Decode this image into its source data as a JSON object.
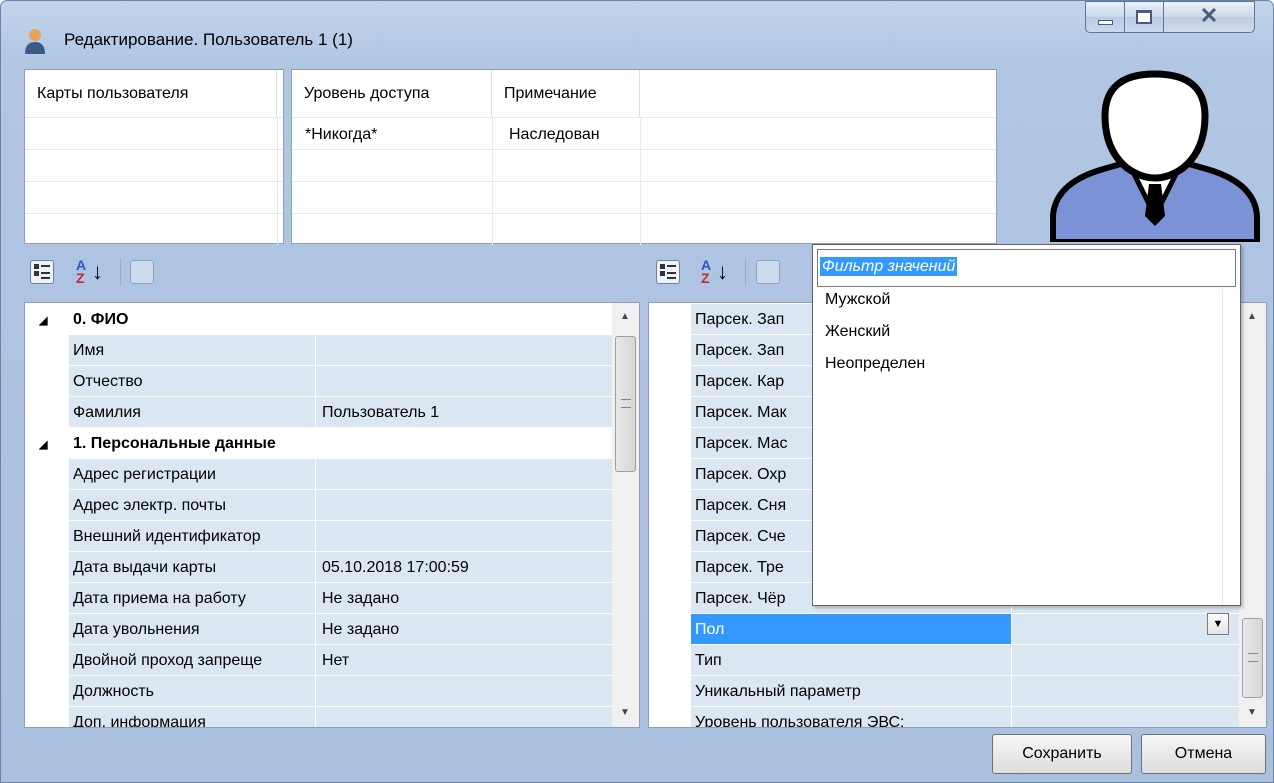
{
  "window": {
    "title": "Редактирование. Пользователь 1 (1)",
    "icons": {
      "app": "user-icon",
      "minimize": "minimize-icon",
      "maximize": "maximize-icon",
      "close": "close-icon"
    }
  },
  "cards_panel": {
    "header": "Карты пользователя"
  },
  "access_panel": {
    "headers": [
      "Уровень доступа",
      "Примечание"
    ],
    "rows": [
      {
        "level": "*Никогда*",
        "note": "Наследован"
      }
    ]
  },
  "avatar": {
    "icon": "person-avatar-icon"
  },
  "left_toolbar": {
    "icons": [
      "categorized-icon",
      "sort-az-icon",
      "property-pages-icon"
    ]
  },
  "right_toolbar": {
    "icons": [
      "categorized-icon",
      "sort-az-icon",
      "property-pages-icon"
    ]
  },
  "left_grid": {
    "rows": [
      {
        "type": "category",
        "name": "0. ФИО"
      },
      {
        "type": "prop",
        "name": "Имя",
        "value": ""
      },
      {
        "type": "prop",
        "name": "Отчество",
        "value": ""
      },
      {
        "type": "prop",
        "name": "Фамилия",
        "value": "Пользователь 1"
      },
      {
        "type": "category",
        "name": "1. Персональные данные"
      },
      {
        "type": "prop",
        "name": "Адрес регистрации",
        "value": ""
      },
      {
        "type": "prop",
        "name": "Адрес электр. почты",
        "value": ""
      },
      {
        "type": "prop",
        "name": "Внешний идентификатор",
        "value": ""
      },
      {
        "type": "prop",
        "name": "Дата выдачи карты",
        "value": "05.10.2018 17:00:59"
      },
      {
        "type": "prop",
        "name": "Дата приема на работу",
        "value": "Не задано"
      },
      {
        "type": "prop",
        "name": "Дата увольнения",
        "value": "Не задано"
      },
      {
        "type": "prop",
        "name": "Двойной проход запреще",
        "value": "Нет"
      },
      {
        "type": "prop",
        "name": "Должность",
        "value": ""
      },
      {
        "type": "prop",
        "name": "Доп. информация",
        "value": ""
      }
    ]
  },
  "right_grid": {
    "rows": [
      {
        "name": "Парсек. Зап",
        "value": ""
      },
      {
        "name": "Парсек. Зап",
        "value": ""
      },
      {
        "name": "Парсек. Кар",
        "value": ""
      },
      {
        "name": "Парсек. Мак",
        "value": ""
      },
      {
        "name": "Парсек. Мас",
        "value": ""
      },
      {
        "name": "Парсек. Охр",
        "value": ""
      },
      {
        "name": "Парсек. Сня",
        "value": ""
      },
      {
        "name": "Парсек. Сче",
        "value": ""
      },
      {
        "name": "Парсек. Тре",
        "value": ""
      },
      {
        "name": "Парсек. Чёр",
        "value": ""
      },
      {
        "name": "Пол",
        "value": "",
        "selected": true
      },
      {
        "name": "Тип",
        "value": ""
      },
      {
        "name": "Уникальный параметр",
        "value": ""
      },
      {
        "name": "Уровень пользователя ЭВС:",
        "value": ""
      }
    ]
  },
  "dropdown": {
    "filter_placeholder": "Фильтр значений",
    "options": [
      "Мужской",
      "Женский",
      "Неопределен"
    ]
  },
  "buttons": {
    "save": "Сохранить",
    "cancel": "Отмена"
  },
  "colors": {
    "selection": "#3399ff",
    "row_fill": "#dbe6f3",
    "frame": "#b0c6e3"
  }
}
